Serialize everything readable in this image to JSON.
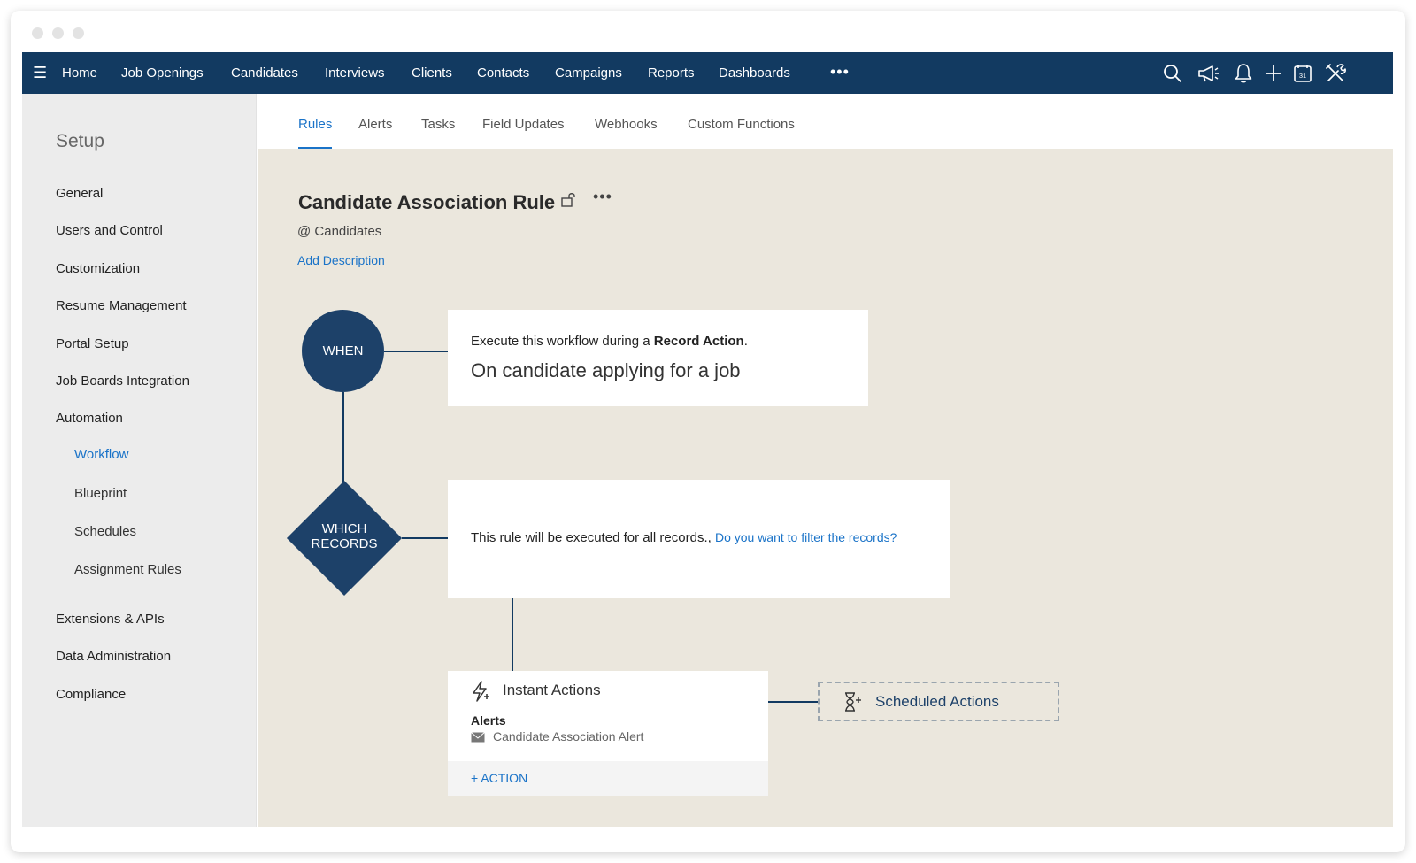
{
  "navbar": {
    "items": [
      "Home",
      "Job Openings",
      "Candidates",
      "Interviews",
      "Clients",
      "Contacts",
      "Campaigns",
      "Reports",
      "Dashboards"
    ],
    "more": "•••",
    "icons": [
      "search-icon",
      "megaphone-icon",
      "bell-icon",
      "plus-icon",
      "calendar-icon",
      "tools-icon"
    ],
    "calendar_day": "31"
  },
  "sidebar": {
    "title": "Setup",
    "items": [
      "General",
      "Users and Control",
      "Customization",
      "Resume Management",
      "Portal Setup",
      "Job Boards Integration",
      "Automation"
    ],
    "automation_sub": [
      "Workflow",
      "Blueprint",
      "Schedules",
      "Assignment Rules"
    ],
    "items_after": [
      "Extensions & APIs",
      "Data Administration",
      "Compliance"
    ]
  },
  "tabs": [
    "Rules",
    "Alerts",
    "Tasks",
    "Field Updates",
    "Webhooks",
    "Custom Functions"
  ],
  "rule": {
    "title": "Candidate Association Rule",
    "more": "•••",
    "module": "@ Candidates",
    "add_description": "Add Description"
  },
  "when": {
    "label": "WHEN",
    "line1_prefix": "Execute this workflow during a ",
    "line1_bold": "Record Action",
    "line1_suffix": ".",
    "line2": "On candidate applying for a job"
  },
  "which": {
    "label_line1": "WHICH",
    "label_line2": "RECORDS",
    "text": "This rule will be executed for all records., ",
    "link": "Do you want to filter the records?"
  },
  "instant": {
    "title": "Instant Actions",
    "alerts_label": "Alerts",
    "alert_name": "Candidate Association Alert",
    "action_button": "+ ACTION"
  },
  "scheduled": {
    "title": "Scheduled Actions"
  },
  "colors": {
    "navbar": "#123a61",
    "accent": "#1a73c8",
    "node": "#1d4169",
    "canvas": "#ebe7dd"
  }
}
